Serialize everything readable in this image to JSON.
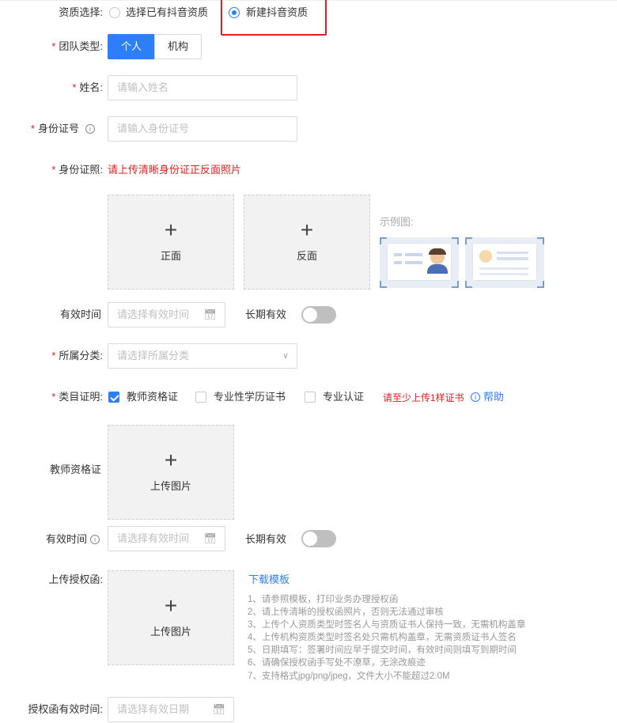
{
  "qualification": {
    "label": "资质选择:",
    "options": [
      "选择已有抖音资质",
      "新建抖音资质"
    ],
    "selected": "新建抖音资质"
  },
  "team_type": {
    "label": "团队类型:",
    "options": [
      "个人",
      "机构"
    ],
    "selected": "个人"
  },
  "name": {
    "label": "姓名:",
    "placeholder": "请输入姓名"
  },
  "id_number": {
    "label": "身份证号",
    "placeholder": "请输入身份证号"
  },
  "id_photo": {
    "label": "身份证照:",
    "hint": "请上传清晰身份证正反面照片",
    "front_label": "正面",
    "back_label": "反面",
    "example_label": "示例图:"
  },
  "validity_1": {
    "label": "有效时间",
    "placeholder": "请选择有效时间",
    "long_term_label": "长期有效",
    "long_term_on": false
  },
  "category": {
    "label": "所属分类:",
    "placeholder": "请选择所属分类"
  },
  "category_proof": {
    "label": "类目证明:",
    "options": [
      {
        "label": "教师资格证",
        "checked": true
      },
      {
        "label": "专业性学历证书",
        "checked": false
      },
      {
        "label": "专业认证",
        "checked": false
      }
    ],
    "warning": "请至少上传1样证书",
    "help_label": "帮助"
  },
  "teacher_cert": {
    "label": "教师资格证",
    "upload_label": "上传图片"
  },
  "validity_2": {
    "label": "有效时间",
    "placeholder": "请选择有效时间",
    "long_term_label": "长期有效",
    "long_term_on": false
  },
  "auth_letter": {
    "label": "上传授权函:",
    "upload_label": "上传图片",
    "download_label": "下载模板",
    "notes": [
      "1、请参照模板，打印业务办理授权函",
      "2、请上传清晰的授权函照片，否则无法通过审核",
      "3、上传个人资质类型时签名人与资质证书人保持一致，无需机构盖章",
      "4、上传机构资质类型时签名处只需机构盖章，无需资质证书人签名",
      "5、日期填写：签署时间应早于提交时间，有效时间则填写到期时间",
      "6、请确保授权函手写处不潦草，无涂改痕迹",
      "7、支持格式jpg/png/jpeg，文件大小不能超过2.0M"
    ]
  },
  "auth_validity": {
    "label": "授权函有效时间:",
    "placeholder": "请选择有效日期"
  },
  "icons": {
    "calendar": "calendar-icon",
    "chevron": "chevron-down-icon",
    "info": "info-icon",
    "plus": "plus-icon"
  },
  "colors": {
    "accent": "#2d7ff9",
    "required": "#e02020",
    "highlight": "#e02020"
  }
}
